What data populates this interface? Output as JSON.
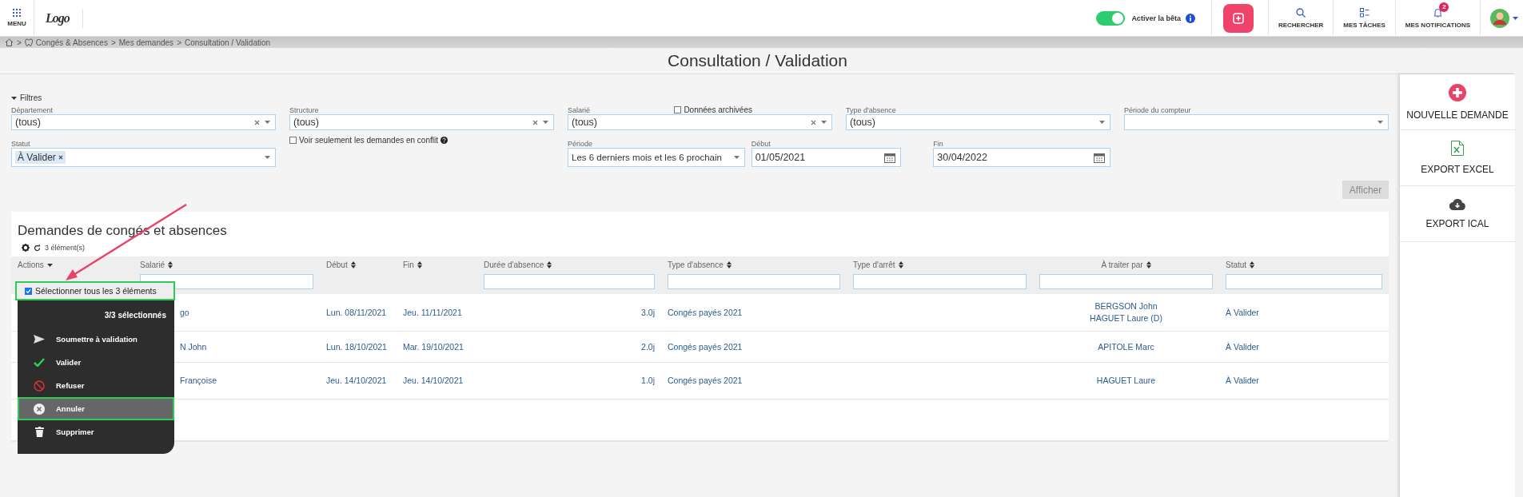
{
  "topbar": {
    "menu_label": "MENU",
    "logo": "Logo",
    "beta_toggle": {
      "label": "Activer la bêta",
      "on": true
    },
    "nav": [
      {
        "kind": "search",
        "label": "RECHERCHER"
      },
      {
        "kind": "tasks",
        "label": "MES TÂCHES"
      },
      {
        "kind": "notifications",
        "label": "MES NOTIFICATIONS",
        "badge": "2"
      }
    ]
  },
  "breadcrumb": [
    {
      "kind": "home"
    },
    {
      "kind": "separator",
      "text": ">"
    },
    {
      "kind": "module",
      "text": "Congés & Absences"
    },
    {
      "kind": "separator",
      "text": ">"
    },
    {
      "kind": "link",
      "text": "Mes demandes"
    },
    {
      "kind": "separator",
      "text": ">"
    },
    {
      "kind": "link",
      "text": "Consultation / Validation"
    }
  ],
  "page_title": "Consultation / Validation",
  "filters": {
    "label": "Filtres",
    "expanded": true,
    "row_1": [
      {
        "label": "Département",
        "value": "(tous)",
        "clearable": true
      },
      {
        "label": "Structure",
        "value": "(tous)",
        "clearable": true
      },
      {
        "label": "Salarié",
        "value": "(tous)",
        "clearable": true,
        "option": {
          "label": "Données archivées",
          "checked": false
        }
      },
      {
        "label": "Type d'absence",
        "value": "(tous)",
        "clearable": false
      },
      {
        "label": "Période du compteur",
        "clearable": false
      }
    ],
    "status": {
      "label": "Statut",
      "tags": [
        "À Valider"
      ]
    },
    "conflict_only": {
      "label": "Voir seulement les demandes en conflit",
      "checked": false
    },
    "period": {
      "label": "Période",
      "value": "Les 6 derniers mois et les 6 prochain"
    },
    "start": {
      "label": "Début",
      "value": "01/05/2021"
    },
    "end": {
      "label": "Fin",
      "value": "30/04/2022"
    },
    "apply_button": {
      "label": "Afficher",
      "disabled": true
    }
  },
  "table": {
    "title": "Demandes de congés et absences",
    "count": "3 élément(s)",
    "columns": [
      {
        "label": "Actions",
        "kind": "menu"
      },
      {
        "label": "Salarié",
        "kind": "filterable"
      },
      {
        "label": "Début",
        "kind": "sortable"
      },
      {
        "label": "Fin",
        "kind": "sortable"
      },
      {
        "label": "Durée d'absence",
        "kind": "filterable"
      },
      {
        "label": "Type d'absence",
        "kind": "filterable"
      },
      {
        "label": "Type d'arrêt",
        "kind": "filterable"
      },
      {
        "label": "À traiter par",
        "kind": "filterable"
      },
      {
        "label": "Statut",
        "kind": "filterable"
      }
    ],
    "rows": [
      {
        "employee": "go",
        "start": "Lun. 08/11/2021",
        "end": "Jeu. 11/11/2021",
        "duration": "3.0j",
        "absence_type": "Congés payés 2021",
        "handlers": [
          "BERGSON John",
          "HAGUET Laure (D)"
        ],
        "status": "À Valider"
      },
      {
        "employee": "N John",
        "start": "Lun. 18/10/2021",
        "end": "Mar. 19/10/2021",
        "duration": "2.0j",
        "absence_type": "Congés payés 2021",
        "handlers": [
          "APITOLE Marc"
        ],
        "status": "À Valider"
      },
      {
        "employee": "Françoise",
        "start": "Jeu. 14/10/2021",
        "end": "Jeu. 14/10/2021",
        "duration": "1.0j",
        "absence_type": "Congés payés 2021",
        "handlers": [
          "HAGUET Laure"
        ],
        "status": "À Valider"
      }
    ],
    "actions_menu": {
      "select_all": {
        "label": "Sélectionner tous les 3 éléments",
        "checked": true
      },
      "summary": "3/3 sélectionnés",
      "items": [
        {
          "kind": "submit",
          "label": "Soumettre à validation",
          "selected": false
        },
        {
          "kind": "validate",
          "label": "Valider",
          "selected": false
        },
        {
          "kind": "refuse",
          "label": "Refuser",
          "selected": false
        },
        {
          "kind": "cancel",
          "label": "Annuler",
          "selected": true
        },
        {
          "kind": "delete",
          "label": "Supprimer",
          "selected": false
        }
      ]
    }
  },
  "sidebar": [
    {
      "kind": "new",
      "label": "NOUVELLE DEMANDE"
    },
    {
      "kind": "excel",
      "label": "EXPORT EXCEL"
    },
    {
      "kind": "ical",
      "label": "EXPORT ICAL"
    }
  ]
}
